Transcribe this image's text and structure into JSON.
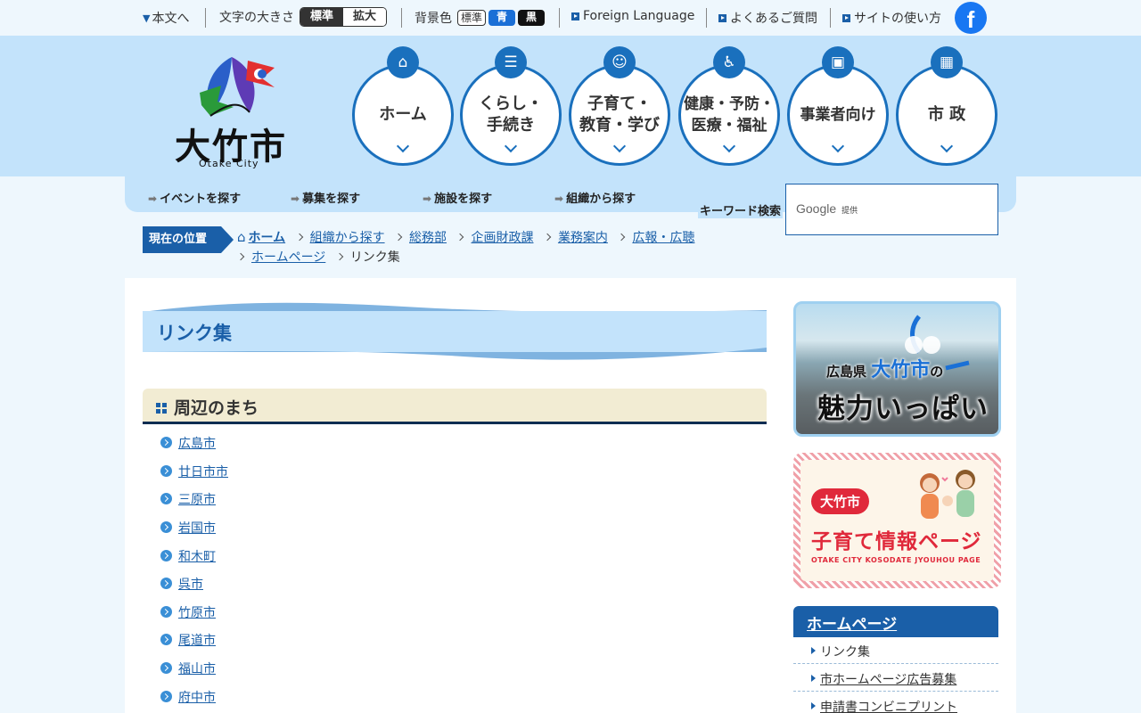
{
  "topbar": {
    "skip_label": "本文へ",
    "font_size_label": "文字の大きさ",
    "font_standard": "標準",
    "font_large": "拡大",
    "bg_color_label": "背景色",
    "bg_standard": "標準",
    "bg_blue": "青",
    "bg_black": "黒",
    "foreign_language": "Foreign Language",
    "faq": "よくあるご質問",
    "site_guide": "サイトの使い方",
    "facebook": "f"
  },
  "logo": {
    "name": "大竹市",
    "romaji": "Otake City"
  },
  "nav": [
    {
      "label": "ホーム",
      "icon": "home-icon"
    },
    {
      "label": "くらし・\n手続き",
      "icon": "document-icon"
    },
    {
      "label": "子育て・\n教育・学び",
      "icon": "baby-icon"
    },
    {
      "label": "健康・予防・\n医療・福祉",
      "icon": "wheelchair-icon"
    },
    {
      "label": "事業者向け",
      "icon": "briefcase-icon"
    },
    {
      "label": "市 政",
      "icon": "building-icon"
    }
  ],
  "subnav": {
    "events": "イベントを探す",
    "recruit": "募集を探す",
    "facilities": "施設を探す",
    "organizations": "組織から探す",
    "keyword_label": "キーワード検索",
    "search_placeholder": "Google",
    "search_provided": "提供"
  },
  "breadcrumb": {
    "label": "現在の位置",
    "items": [
      "ホーム",
      "組織から探す",
      "総務部",
      "企画財政課",
      "業務案内",
      "広報・広聴",
      "ホームページ"
    ],
    "current": "リンク集"
  },
  "page": {
    "title": "リンク集"
  },
  "section": {
    "title": "周辺のまち",
    "links": [
      "広島市",
      "廿日市市",
      "三原市",
      "岩国市",
      "和木町",
      "呉市",
      "竹原市",
      "尾道市",
      "福山市",
      "府中市"
    ]
  },
  "banners": {
    "charm_line1_pref": "広島県",
    "charm_line1_city": "大竹市",
    "charm_line1_suffix": "の",
    "charm_line2": "魅力いっぱい",
    "kosodate_pill": "大竹市",
    "kosodate_title": "子育て情報ページ",
    "kosodate_sub": "OTAKE CITY KOSODATE JYOUHOU PAGE"
  },
  "side_menu": {
    "title": "ホームページ",
    "items": [
      "リンク集",
      "市ホームページ広告募集",
      "申請書コンビニプリント"
    ]
  },
  "colors": {
    "primary": "#1a5fa8",
    "header_bg": "#c3e3fb",
    "section_bg": "#f2ecd3",
    "kosodate_red": "#e0293b"
  }
}
